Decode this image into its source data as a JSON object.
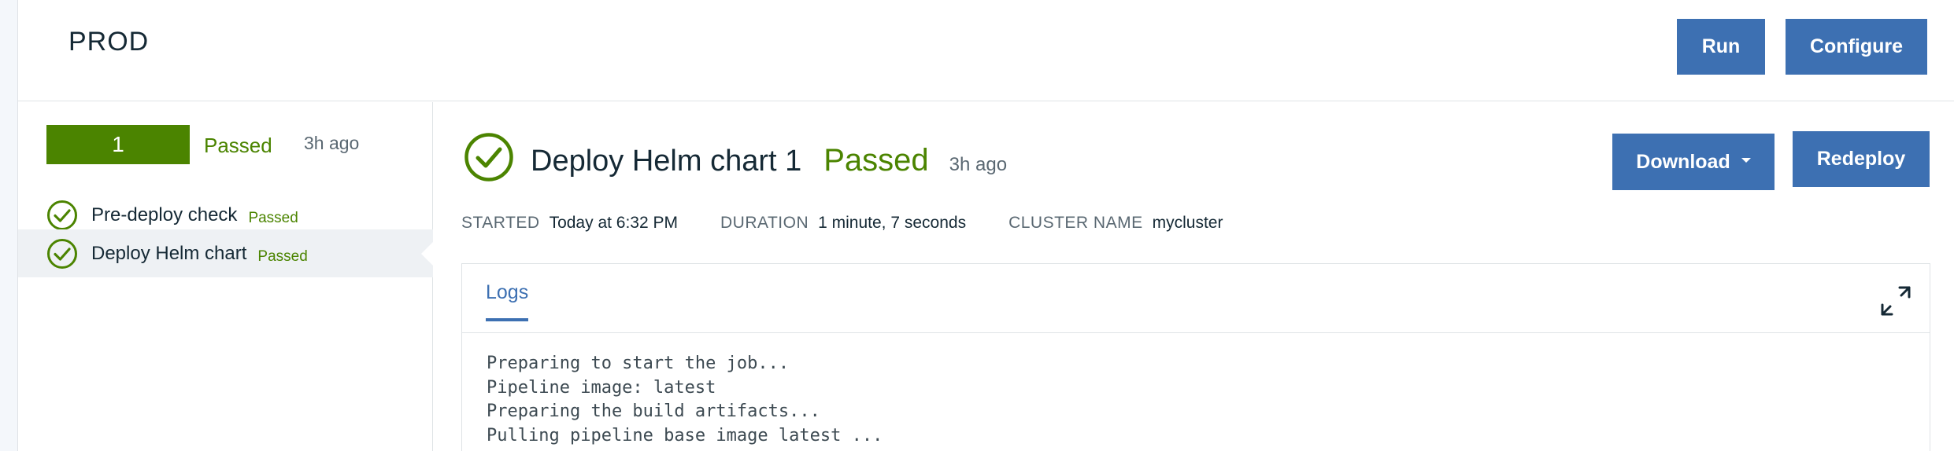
{
  "header": {
    "title": "PROD",
    "run_label": "Run",
    "configure_label": "Configure"
  },
  "sidebar": {
    "run": {
      "number": "1",
      "status": "Passed",
      "time": "3h ago"
    },
    "jobs": [
      {
        "name": "Pre-deploy check",
        "status": "Passed"
      },
      {
        "name": "Deploy Helm chart",
        "status": "Passed"
      }
    ]
  },
  "detail": {
    "title": "Deploy Helm chart 1",
    "status": "Passed",
    "time": "3h ago",
    "download_label": "Download",
    "redeploy_label": "Redeploy",
    "meta": {
      "started_label": "STARTED",
      "started_value": "Today at 6:32 PM",
      "duration_label": "DURATION",
      "duration_value": "1 minute, 7 seconds",
      "cluster_label": "CLUSTER NAME",
      "cluster_value": "mycluster"
    }
  },
  "logs": {
    "tab_label": "Logs",
    "lines": [
      "Preparing to start the job...",
      "Pipeline image: latest",
      "Preparing the build artifacts...",
      "Pulling pipeline base image latest ..."
    ]
  },
  "icons": {
    "status_check": "check-circle-icon",
    "expand": "maximize-icon"
  },
  "colors": {
    "primary": "#3d70b2",
    "success": "#4b8400",
    "text": "#152935",
    "muted": "#5a6872",
    "border": "#dfe3e6",
    "selected_bg": "#eef1f4"
  }
}
